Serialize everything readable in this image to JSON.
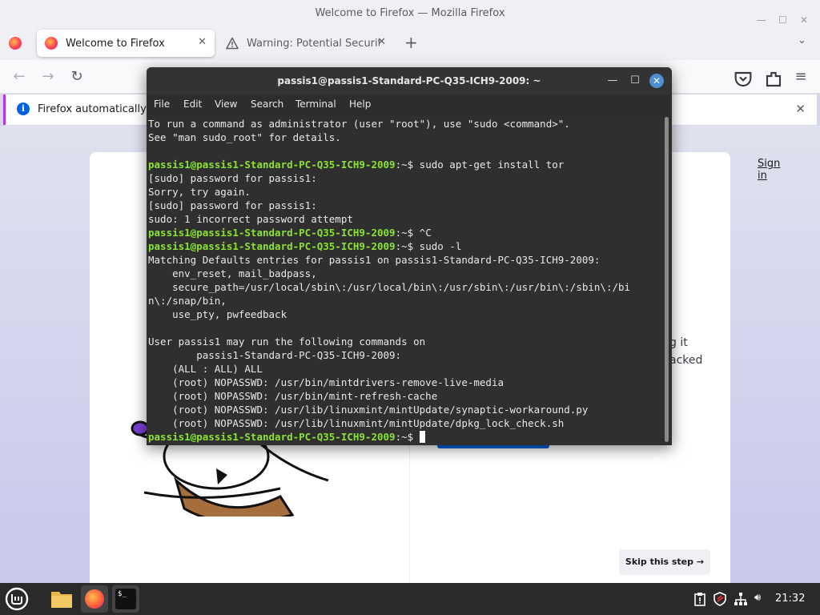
{
  "firefox": {
    "window_title": "Welcome to Firefox — Mozilla Firefox",
    "tabs": [
      {
        "label": "Welcome to Firefox",
        "icon": "firefox-icon",
        "active": true
      },
      {
        "label": "Warning: Potential Security Risk Ahead",
        "icon": "warning-icon",
        "active": false
      }
    ],
    "new_tab_label": "+",
    "info_text": "Firefox automatically sends some data to Mozilla so that we can improve your experience.",
    "sign_in_label": "Sign in",
    "peek_text_1": "g it",
    "peek_text_2": "acked",
    "skip_label": "Skip this step →"
  },
  "terminal": {
    "title": "passis1@passis1-Standard-PC-Q35-ICH9-2009: ~",
    "menu": [
      "File",
      "Edit",
      "View",
      "Search",
      "Terminal",
      "Help"
    ],
    "prompt_user": "passis1@passis1-Standard-PC-Q35-ICH9-2009",
    "prompt_sep": ":~$ ",
    "lines": [
      {
        "t": "To run a command as administrator (user \"root\"), use \"sudo <command>\"."
      },
      {
        "t": "See \"man sudo_root\" for details."
      },
      {
        "t": ""
      },
      {
        "p": "passis1@passis1-Standard-PC-Q35-ICH9-2009",
        "s": ":~$ ",
        "t": "sudo apt-get install tor"
      },
      {
        "t": "[sudo] password for passis1:"
      },
      {
        "t": "Sorry, try again."
      },
      {
        "t": "[sudo] password for passis1:"
      },
      {
        "t": "sudo: 1 incorrect password attempt"
      },
      {
        "p": "passis1@passis1-Standard-PC-Q35-ICH9-2009",
        "s": ":~$ ",
        "t": "^C"
      },
      {
        "p": "passis1@passis1-Standard-PC-Q35-ICH9-2009",
        "s": ":~$ ",
        "t": "sudo -l"
      },
      {
        "t": "Matching Defaults entries for passis1 on passis1-Standard-PC-Q35-ICH9-2009:"
      },
      {
        "t": "    env_reset, mail_badpass,"
      },
      {
        "t": "    secure_path=/usr/local/sbin\\:/usr/local/bin\\:/usr/sbin\\:/usr/bin\\:/sbin\\:/bi"
      },
      {
        "t": "n\\:/snap/bin,"
      },
      {
        "t": "    use_pty, pwfeedback"
      },
      {
        "t": ""
      },
      {
        "t": "User passis1 may run the following commands on"
      },
      {
        "t": "        passis1-Standard-PC-Q35-ICH9-2009:"
      },
      {
        "t": "    (ALL : ALL) ALL"
      },
      {
        "t": "    (root) NOPASSWD: /usr/bin/mintdrivers-remove-live-media"
      },
      {
        "t": "    (root) NOPASSWD: /usr/bin/mint-refresh-cache"
      },
      {
        "t": "    (root) NOPASSWD: /usr/lib/linuxmint/mintUpdate/synaptic-workaround.py"
      },
      {
        "t": "    (root) NOPASSWD: /usr/lib/linuxmint/mintUpdate/dpkg_lock_check.sh"
      },
      {
        "p": "passis1@passis1-Standard-PC-Q35-ICH9-2009",
        "s": ":~$ ",
        "t": "",
        "cursor": true
      }
    ]
  },
  "taskbar": {
    "clock": "21:32",
    "apps": [
      "mint-menu-icon",
      "files-icon",
      "firefox-icon",
      "terminal-icon"
    ]
  },
  "colors": {
    "prompt": "#8ae234",
    "terminal_bg": "#2f2f2f",
    "accent": "#0061e0"
  }
}
